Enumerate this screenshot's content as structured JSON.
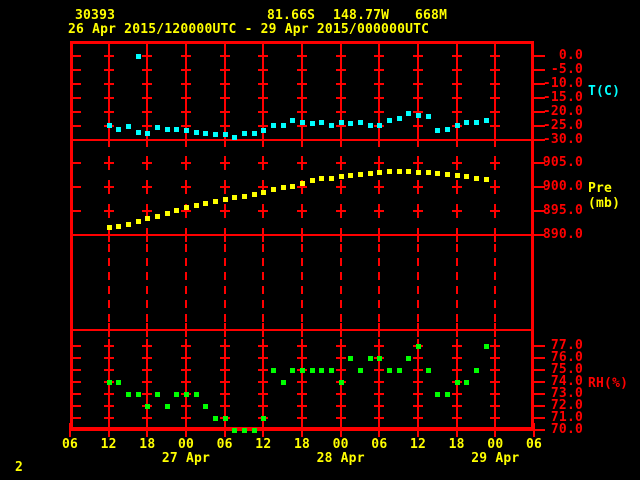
{
  "header": {
    "station_id": "30393",
    "latitude": "81.66S",
    "longitude": "148.77W",
    "elevation": "668M",
    "time_range": "26 Apr 2015/120000UTC - 29 Apr 2015/000000UTC"
  },
  "footer": {
    "page_number": "2"
  },
  "colors": {
    "background": "#000000",
    "grid": "#ff0000",
    "axis_text": "#ff0000",
    "header_text": "#ffff00",
    "temperature": "#00ffff",
    "pressure": "#ffff00",
    "humidity": "#00ff00"
  },
  "chart_data": {
    "type": "scatter",
    "title": "26 Apr 2015/120000UTC - 29 Apr 2015/000000UTC",
    "station": "30393",
    "location": {
      "lat": "81.66S",
      "lon": "148.77W",
      "elev": "668M"
    },
    "x_axis": {
      "start": "26 Apr 2015 06UTC",
      "hours_span": 72,
      "tick_interval_hours": 6,
      "tick_labels": [
        "06",
        "12",
        "18",
        "00",
        "06",
        "12",
        "18",
        "00",
        "06",
        "12",
        "18",
        "00",
        "06"
      ],
      "date_labels": [
        {
          "hour": 18,
          "label": "27 Apr"
        },
        {
          "hour": 42,
          "label": "28 Apr"
        },
        {
          "hour": 66,
          "label": "29 Apr"
        }
      ]
    },
    "sample_hours": [
      6,
      7.5,
      9,
      10.5,
      12,
      13.5,
      15,
      16.5,
      18,
      19.5,
      21,
      22.5,
      24,
      25.5,
      27,
      28.5,
      30,
      31.5,
      33,
      34.5,
      36,
      37.5,
      39,
      40.5,
      42,
      43.5,
      45,
      46.5,
      48,
      49.5,
      51,
      52.5,
      54,
      55.5,
      57,
      58.5,
      60,
      61.5,
      63,
      64.5
    ],
    "panels": [
      {
        "id": "temperature",
        "unit_label": "T(C)",
        "unit_label_color": "#00ffff",
        "point_color": "#00ffff",
        "ylim": [
          -30,
          5
        ],
        "ytick_values": [
          0,
          -5,
          -10,
          -15,
          -20,
          -25,
          -30
        ],
        "ytick_labels": [
          "0.0",
          "-5.0",
          "-10.0",
          "-15.0",
          "-20.0",
          "-25.0",
          "-30.0"
        ],
        "grid_cross_values": [
          0,
          -5,
          -10,
          -15,
          -20,
          -25
        ],
        "values": [
          -24.5,
          -26,
          -25,
          -27,
          -27.5,
          -25.5,
          -26,
          -26,
          -26.5,
          -27,
          -27.5,
          -28,
          -28,
          -29,
          -27.5,
          -27.5,
          -26.5,
          -24.5,
          -24.5,
          -23,
          -23.5,
          -24,
          -23.5,
          -24.5,
          -23.5,
          -24,
          -23.5,
          -24.5,
          -24.5,
          -23,
          -22,
          -20.5,
          -21,
          -21.5,
          -26.5,
          -26,
          -24.5,
          -23.5,
          -23.5,
          -23
        ],
        "extra_points": [
          {
            "hour": 10.5,
            "value": 0.0
          }
        ]
      },
      {
        "id": "pressure",
        "unit_label": "Pre (mb)",
        "unit_label_color": "#ffff00",
        "point_color": "#ffff00",
        "ylim": [
          890,
          910
        ],
        "ytick_values": [
          905,
          900,
          895,
          890
        ],
        "ytick_labels": [
          "905.0",
          "900.0",
          "895.0",
          "890.0"
        ],
        "grid_cross_values": [
          905,
          900,
          895
        ],
        "values": [
          891.6,
          891.9,
          892.3,
          893.0,
          893.5,
          894.0,
          894.5,
          895.3,
          895.8,
          896.3,
          896.7,
          897.1,
          897.5,
          897.9,
          898.1,
          898.5,
          899.0,
          899.6,
          899.9,
          900.3,
          900.9,
          901.4,
          901.8,
          901.9,
          902.3,
          902.5,
          902.7,
          903.0,
          903.2,
          903.4,
          903.4,
          903.3,
          903.2,
          903.1,
          903.0,
          902.7,
          902.5,
          902.2,
          901.9,
          901.6
        ],
        "extra_points": []
      },
      {
        "id": "spare",
        "unit_label": "",
        "unit_label_color": "#ff0000",
        "point_color": "#ff0000",
        "ylim": [
          0,
          1
        ],
        "ytick_values": [],
        "ytick_labels": [],
        "grid_cross_values": [],
        "grid_style": "dashed",
        "values": [],
        "extra_points": []
      },
      {
        "id": "humidity",
        "unit_label": "RH(%)",
        "unit_label_color": "#ff0000",
        "point_color": "#00ff00",
        "ylim": [
          70,
          78
        ],
        "ytick_values": [
          77,
          76,
          75,
          74,
          73,
          72,
          71,
          70
        ],
        "ytick_labels": [
          "77.0",
          "76.0",
          "75.0",
          "74.0",
          "73.0",
          "72.0",
          "71.0",
          "70.0"
        ],
        "grid_cross_values": [
          77,
          76,
          75,
          74,
          73,
          72,
          71
        ],
        "values": [
          74,
          74,
          73,
          73,
          72,
          73,
          72,
          73,
          73,
          73,
          72,
          71,
          71,
          70,
          70,
          70,
          71,
          75,
          74,
          75,
          75,
          75,
          75,
          75,
          74,
          76,
          75,
          76,
          76,
          75,
          75,
          76,
          77,
          75,
          73,
          73,
          74,
          74,
          75,
          77
        ],
        "extra_points": []
      }
    ]
  }
}
